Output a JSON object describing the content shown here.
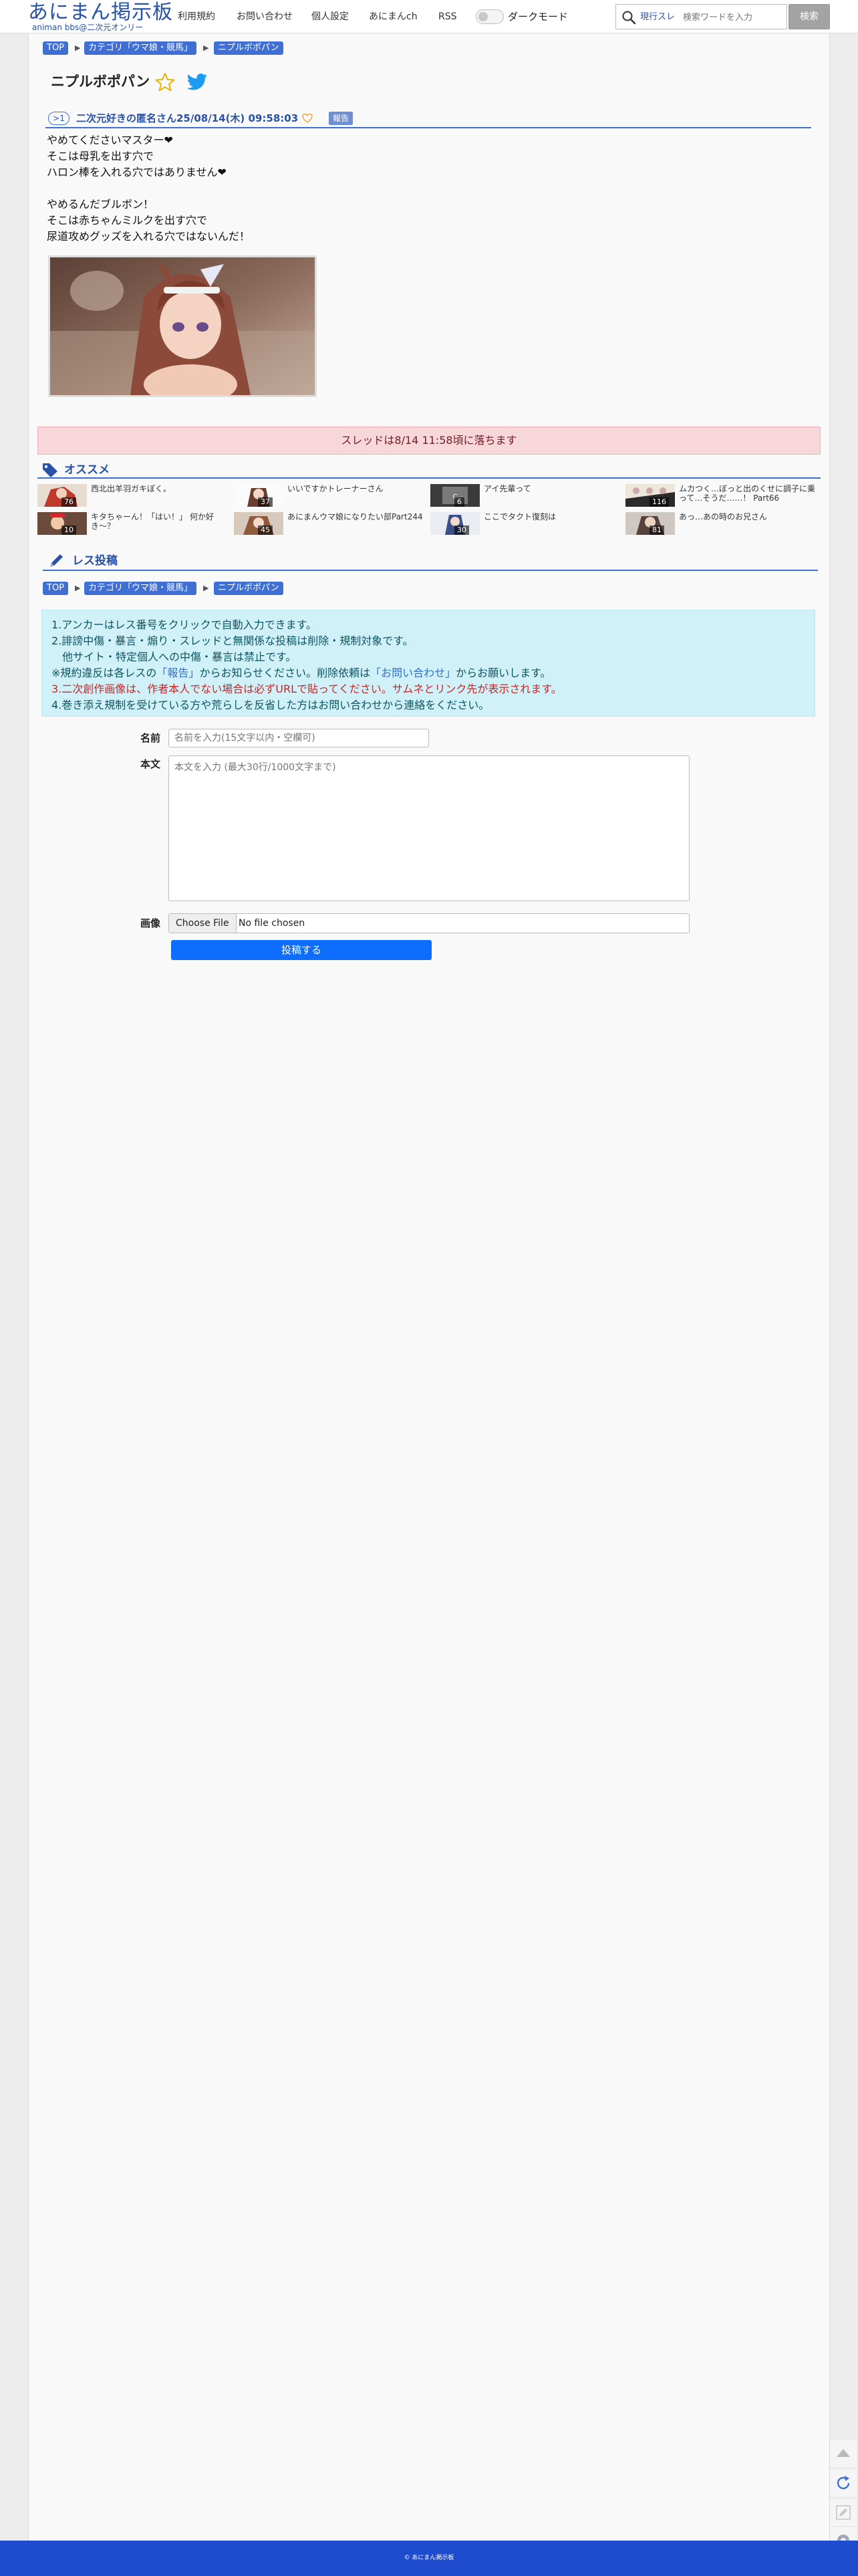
{
  "header": {
    "logo_main": "あにまん掲示板",
    "logo_sub": "animan bbs@二次元オンリー",
    "nav": [
      "利用規約",
      "お問い合わせ",
      "個人設定",
      "あにまんch",
      "RSS"
    ],
    "dark_mode_label": "ダークモード",
    "search_scope": "現行スレ",
    "search_placeholder": "検索ワードを入力",
    "search_button": "検索"
  },
  "breadcrumb": [
    "TOP",
    "カテゴリ「ウマ娘・競馬」",
    "ニプルボポパン"
  ],
  "thread": {
    "title": "ニプルボポパン",
    "post": {
      "number": ">1",
      "author": "二次元好きの匿名さん",
      "date": "25/08/14(木) 09:58:03",
      "report_label": "報告",
      "lines": [
        "やめてくださいマスター❤︎",
        "そこは母乳を出す穴で",
        "ハロン棒を入れる穴ではありません❤︎",
        "",
        "やめるんだブルボン！",
        "そこは赤ちゃんミルクを出す穴で",
        "尿道攻めグッズを入れる穴ではないんだ！"
      ]
    }
  },
  "drop_notice": "スレッドは8/14 11:58頃に落ちます",
  "recommend": {
    "heading": "オススメ",
    "items": [
      {
        "title": "西北出羊羽ガキぼく。",
        "count": "76"
      },
      {
        "title": "いいですかトレーナーさん",
        "count": "37"
      },
      {
        "title": "アイ先輩って",
        "count": "6"
      },
      {
        "title": "ムカつく…ぼっと出のくせに調子に乗って…そうだ……！ Part66",
        "count": "116"
      },
      {
        "title": "キタちゃーん！「はい！」 何か好き〜？",
        "count": "10"
      },
      {
        "title": "あにまんウマ娘になりたい部Part244",
        "count": "45"
      },
      {
        "title": "ここでタクト復刻は",
        "count": "30"
      },
      {
        "title": "あっ…あの時のお兄さん",
        "count": "81"
      }
    ]
  },
  "reply": {
    "heading": "レス投稿",
    "rules": [
      "1.アンカーはレス番号をクリックで自動入力できます。",
      "2.誹謗中傷・暴言・煽り・スレッドと無関係な投稿は削除・規制対象です。",
      "　他サイト・特定個人への中傷・暴言は禁止です。",
      "※規約違反は各レスの「報告」からお知らせください。削除依頼は「お問い合わせ」からお願いします。",
      "3.二次創作画像は、作者本人でない場合は必ずURLで貼ってください。サムネとリンク先が表示されます。",
      "4.巻き添え規制を受けている方や荒らしを反省した方はお問い合わせから連絡をください。"
    ],
    "rule4_prefix": "※規約違反は各レスの",
    "rule4_link1": "「報告」",
    "rule4_mid": "からお知らせください。削除依頼は",
    "rule4_link2": "「お問い合わせ」",
    "rule4_suffix": "からお願いします。",
    "name_label": "名前",
    "name_placeholder": "名前を入力(15文字以内・空欄可)",
    "body_label": "本文",
    "body_placeholder": "本文を入力 (最大30行/1000文字まで)",
    "image_label": "画像",
    "file_button": "Choose File",
    "file_status": "No file chosen",
    "submit": "投稿する"
  },
  "footer": "© あにまん掲示板",
  "colors": {
    "brand_blue": "#2752a8",
    "accent_blue": "#3f6fd3",
    "footer_blue": "#1f4ccf",
    "notice_pink": "#f8d7da",
    "info_cyan": "#d1f1f8",
    "submit_blue": "#0d6efd"
  },
  "icons": [
    "search-icon",
    "star-icon",
    "twitter-icon",
    "heart-icon",
    "tag-icon",
    "pencil-icon",
    "scroll-top-icon",
    "reload-icon",
    "edit-icon",
    "settings-icon"
  ]
}
